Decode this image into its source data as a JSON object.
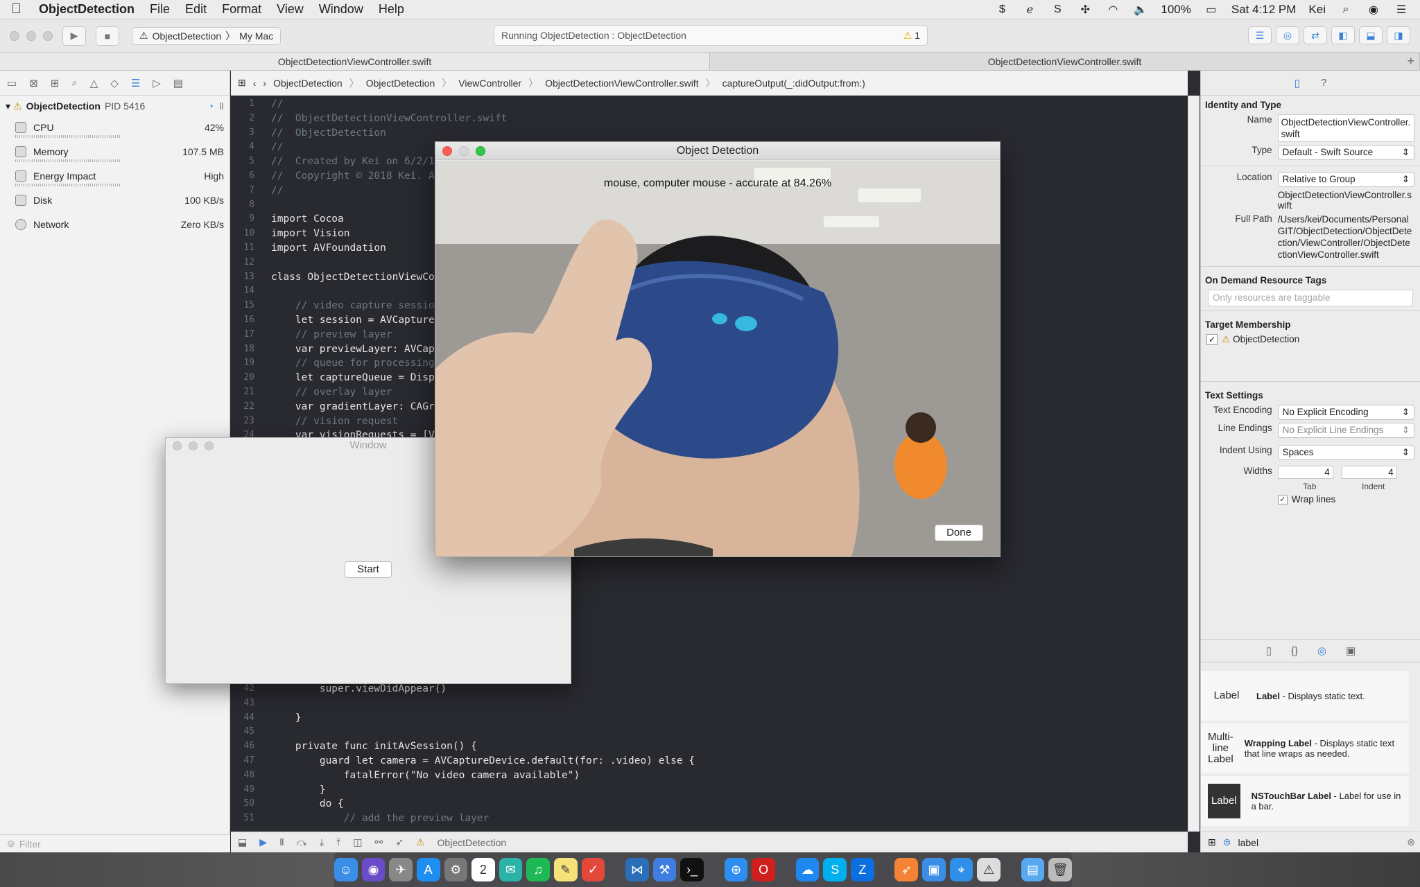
{
  "menubar": {
    "app_name": "ObjectDetection",
    "items": [
      "File",
      "Edit",
      "Format",
      "View",
      "Window",
      "Help"
    ],
    "battery": "100%",
    "clock": "Sat 4:12 PM",
    "user": "Kei"
  },
  "toolbar": {
    "scheme_target": "ObjectDetection",
    "scheme_device": "My Mac",
    "activity_status": "Running ObjectDetection : ObjectDetection",
    "warning_count": "1"
  },
  "tabs": [
    "ObjectDetectionViewController.swift",
    "ObjectDetectionViewController.swift"
  ],
  "navigator": {
    "process_name": "ObjectDetection",
    "process_pid": "PID 5416",
    "gauges": [
      {
        "label": "CPU",
        "value": "42%"
      },
      {
        "label": "Memory",
        "value": "107.5 MB"
      },
      {
        "label": "Energy Impact",
        "value": "High"
      },
      {
        "label": "Disk",
        "value": "100 KB/s"
      },
      {
        "label": "Network",
        "value": "Zero KB/s"
      }
    ],
    "filter_placeholder": "Filter"
  },
  "jumpbar": [
    "ObjectDetection",
    "ObjectDetection",
    "ViewController",
    "ObjectDetectionViewController.swift",
    "captureOutput(_:didOutput:from:)"
  ],
  "code_top": [
    {
      "n": "1",
      "t": "//",
      "c": "cm"
    },
    {
      "n": "2",
      "t": "//  ObjectDetectionViewController.swift",
      "c": "cm"
    },
    {
      "n": "3",
      "t": "//  ObjectDetection",
      "c": "cm"
    },
    {
      "n": "4",
      "t": "//",
      "c": "cm"
    },
    {
      "n": "5",
      "t": "//  Created by Kei on 6/2/18.",
      "c": "cm"
    },
    {
      "n": "6",
      "t": "//  Copyright © 2018 Kei. All rights reserved.",
      "c": "cm"
    },
    {
      "n": "7",
      "t": "//",
      "c": "cm"
    },
    {
      "n": "8",
      "t": "",
      "c": ""
    },
    {
      "n": "9",
      "t": "import Cocoa",
      "c": "kw"
    },
    {
      "n": "10",
      "t": "import Vision",
      "c": "kw"
    },
    {
      "n": "11",
      "t": "import AVFoundation",
      "c": "kw"
    },
    {
      "n": "12",
      "t": "",
      "c": ""
    },
    {
      "n": "13",
      "t": "class ObjectDetectionViewController",
      "c": "kw"
    },
    {
      "n": "14",
      "t": "",
      "c": ""
    },
    {
      "n": "15",
      "t": "    // video capture session",
      "c": "cm"
    },
    {
      "n": "16",
      "t": "    let session = AVCaptureSession()",
      "c": ""
    },
    {
      "n": "17",
      "t": "    // preview layer",
      "c": "cm"
    },
    {
      "n": "18",
      "t": "    var previewLayer: AVCaptureVideoPreviewLayer!",
      "c": ""
    },
    {
      "n": "19",
      "t": "    // queue for processing",
      "c": "cm"
    },
    {
      "n": "20",
      "t": "    let captureQueue = DispatchQueue(label: \"captureQueue\")",
      "c": ""
    },
    {
      "n": "21",
      "t": "    // overlay layer",
      "c": "cm"
    },
    {
      "n": "22",
      "t": "    var gradientLayer: CAGradientLayer!",
      "c": ""
    },
    {
      "n": "23",
      "t": "    // vision request",
      "c": "cm"
    },
    {
      "n": "24",
      "t": "    var visionRequests = [VNRequest]()",
      "c": ""
    }
  ],
  "code_bottom": [
    {
      "n": "42",
      "t": "        super.viewDidAppear()",
      "c": ""
    },
    {
      "n": "43",
      "t": "",
      "c": ""
    },
    {
      "n": "44",
      "t": "    }",
      "c": ""
    },
    {
      "n": "45",
      "t": "",
      "c": ""
    },
    {
      "n": "46",
      "t": "    private func initAvSession() {",
      "c": ""
    },
    {
      "n": "47",
      "t": "        guard let camera = AVCaptureDevice.default(for: .video) else {",
      "c": ""
    },
    {
      "n": "48",
      "t": "            fatalError(\"No video camera available\")",
      "c": ""
    },
    {
      "n": "49",
      "t": "        }",
      "c": ""
    },
    {
      "n": "50",
      "t": "        do {",
      "c": ""
    },
    {
      "n": "51",
      "t": "            // add the preview layer",
      "c": "cm"
    }
  ],
  "debugbar": {
    "process": "ObjectDetection"
  },
  "inspector": {
    "identity_title": "Identity and Type",
    "name_label": "Name",
    "name_value": "ObjectDetectionViewController.swift",
    "type_label": "Type",
    "type_value": "Default - Swift Source",
    "location_label": "Location",
    "location_value": "Relative to Group",
    "location_file": "ObjectDetectionViewController.swift",
    "fullpath_label": "Full Path",
    "fullpath_value": "/Users/kei/Documents/PersonalGIT/ObjectDetection/ObjectDetection/ViewController/ObjectDetectionViewController.swift",
    "odr_title": "On Demand Resource Tags",
    "odr_placeholder": "Only resources are taggable",
    "target_title": "Target Membership",
    "target_name": "ObjectDetection",
    "text_title": "Text Settings",
    "encoding_label": "Text Encoding",
    "encoding_value": "No Explicit Encoding",
    "endings_label": "Line Endings",
    "endings_value": "No Explicit Line Endings",
    "indent_label": "Indent Using",
    "indent_value": "Spaces",
    "widths_label": "Widths",
    "tab_width": "4",
    "indent_width": "4",
    "tab_caption": "Tab",
    "indent_caption": "Indent",
    "wrap_label": "Wrap lines"
  },
  "library": {
    "items": [
      {
        "icon": "Label",
        "title": "Label",
        "desc": " - Displays static text."
      },
      {
        "icon": "Multi-line Label",
        "title": "Wrapping Label",
        "desc": " - Displays static text that line wraps as needed."
      },
      {
        "icon": "Label",
        "title": "NSTouchBar Label",
        "desc": " - Label for use in a bar."
      }
    ],
    "filter_value": "label"
  },
  "window_small": {
    "title": "Window",
    "start_label": "Start"
  },
  "window_camera": {
    "title": "Object Detection",
    "result": "mouse, computer mouse - accurate at 84.26%",
    "done_label": "Done"
  }
}
